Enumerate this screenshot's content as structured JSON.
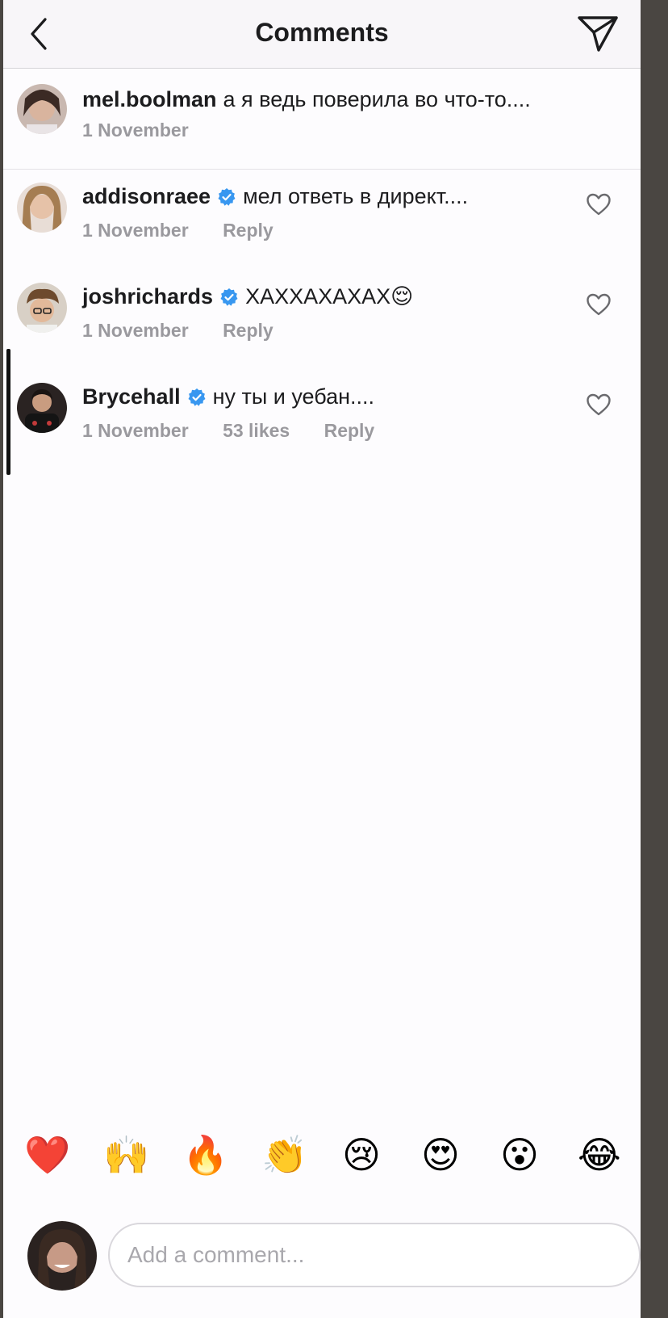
{
  "header": {
    "title": "Comments",
    "back_icon": "chevron-left-icon",
    "share_icon": "paper-plane-icon"
  },
  "caption": {
    "username": "mel.boolman",
    "text": "а я ведь поверила во что-то....",
    "date": "1 November"
  },
  "comments": [
    {
      "username": "addisonraee",
      "verified": true,
      "text": "мел ответь в директ....",
      "date": "1 November",
      "likes": "",
      "reply": "Reply"
    },
    {
      "username": "joshrichards",
      "verified": true,
      "text": "ХАХХАХАХАХ😌",
      "date": "1 November",
      "likes": "",
      "reply": "Reply"
    },
    {
      "username": "Brycehall",
      "verified": true,
      "text": "ну ты и уебан....",
      "date": "1 November",
      "likes": "53 likes",
      "reply": "Reply"
    }
  ],
  "quick_reactions": [
    "❤️",
    "🙌",
    "🔥",
    "👏",
    "😢",
    "😍",
    "😮",
    "😂"
  ],
  "composer": {
    "placeholder": "Add a comment..."
  },
  "colors": {
    "verified": "#3897f0",
    "muted": "#9a999e",
    "text": "#1c1c1e"
  }
}
